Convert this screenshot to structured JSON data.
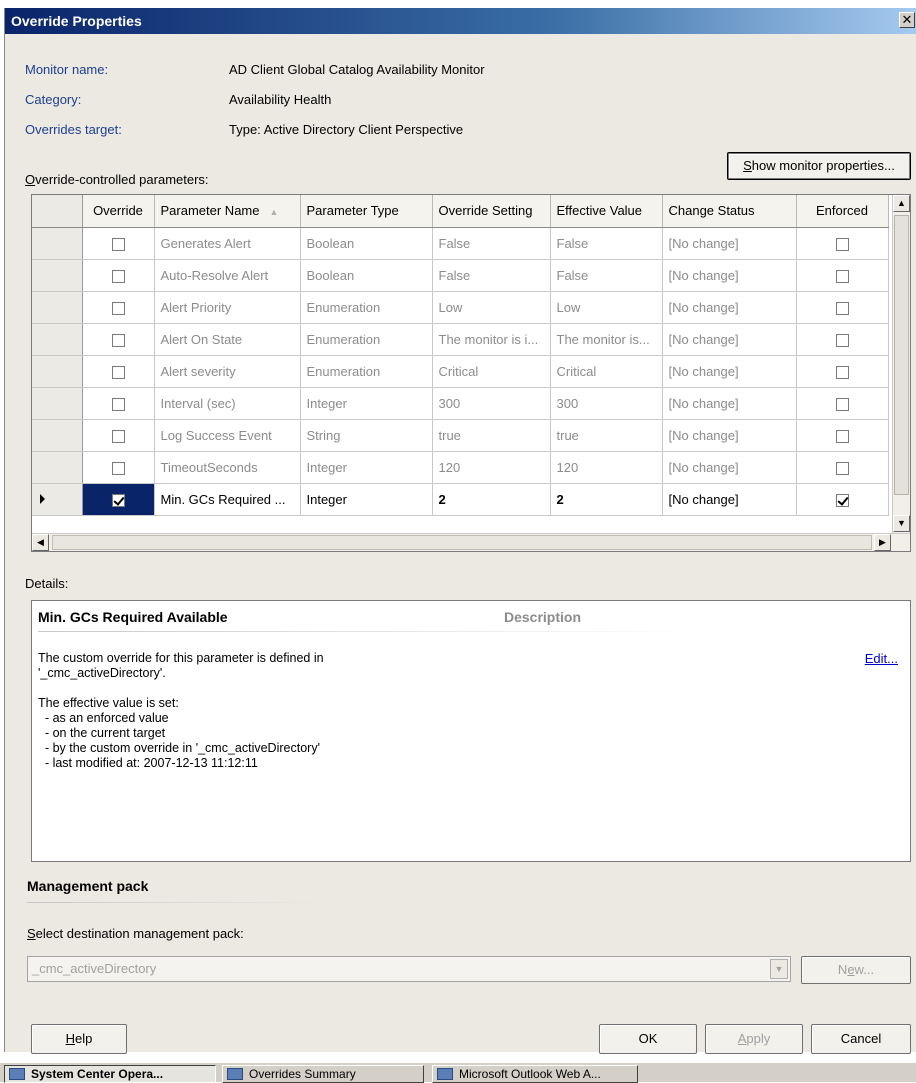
{
  "window": {
    "title": "Override Properties",
    "close_glyph": "✕"
  },
  "info": {
    "monitor_name_label": "Monitor name:",
    "monitor_name_value": "AD Client Global Catalog Availability Monitor",
    "category_label": "Category:",
    "category_value": "Availability Health",
    "overrides_target_label": "Overrides target:",
    "overrides_target_value": "Type: Active Directory Client Perspective"
  },
  "params": {
    "label_mnemonic": "O",
    "label_rest": "verride-controlled parameters:",
    "show_button_mnemonic": "S",
    "show_button_rest": "how monitor properties..."
  },
  "grid": {
    "columns": [
      "Override",
      "Parameter Name",
      "Parameter Type",
      "Override Setting",
      "Effective Value",
      "Change Status",
      "Enforced"
    ],
    "sort_icon": "▲",
    "rows": [
      {
        "override": false,
        "name": "Generates Alert",
        "type": "Boolean",
        "setting": "False",
        "effective": "False",
        "status": "[No change]",
        "enforced": false
      },
      {
        "override": false,
        "name": "Auto-Resolve Alert",
        "type": "Boolean",
        "setting": "False",
        "effective": "False",
        "status": "[No change]",
        "enforced": false
      },
      {
        "override": false,
        "name": "Alert Priority",
        "type": "Enumeration",
        "setting": "Low",
        "effective": "Low",
        "status": "[No change]",
        "enforced": false
      },
      {
        "override": false,
        "name": "Alert On State",
        "type": "Enumeration",
        "setting": "The monitor is i...",
        "effective": "The monitor is...",
        "status": "[No change]",
        "enforced": false
      },
      {
        "override": false,
        "name": "Alert severity",
        "type": "Enumeration",
        "setting": "Critical",
        "effective": "Critical",
        "status": "[No change]",
        "enforced": false
      },
      {
        "override": false,
        "name": "Interval (sec)",
        "type": "Integer",
        "setting": "300",
        "effective": "300",
        "status": "[No change]",
        "enforced": false
      },
      {
        "override": false,
        "name": "Log Success Event",
        "type": "String",
        "setting": "true",
        "effective": "true",
        "status": "[No change]",
        "enforced": false
      },
      {
        "override": false,
        "name": "TimeoutSeconds",
        "type": "Integer",
        "setting": "120",
        "effective": "120",
        "status": "[No change]",
        "enforced": false
      },
      {
        "override": true,
        "name": "Min. GCs Required ...",
        "type": "Integer",
        "setting": "2",
        "effective": "2",
        "status": "[No change]",
        "enforced": true,
        "selected": true
      }
    ]
  },
  "details": {
    "label": "Details:",
    "title": "Min. GCs Required Available",
    "description_header": "Description",
    "edit_link": "Edit...",
    "lines": [
      "The custom override for this parameter is defined in",
      "'_cmc_activeDirectory'.",
      "",
      "The effective value is set:",
      "  - as an enforced value",
      "  - on the current target",
      "  - by the custom override in '_cmc_activeDirectory'",
      "  - last modified at: 2007-12-13 11:12:11"
    ]
  },
  "management_pack": {
    "title": "Management pack",
    "select_label_mnemonic": "S",
    "select_label_rest": "elect destination management pack:",
    "selected_value": "_cmc_activeDirectory",
    "new_button_mnemonic": "e",
    "new_button_pre": "N",
    "new_button_post": "w..."
  },
  "buttons": {
    "help_mnemonic": "H",
    "help_rest": "elp",
    "ok": "OK",
    "apply_mnemonic": "A",
    "apply_rest": "pply",
    "cancel": "Cancel"
  },
  "taskbar": {
    "items": [
      "System Center Opera...",
      "Overrides Summary",
      "Microsoft Outlook Web A..."
    ]
  }
}
